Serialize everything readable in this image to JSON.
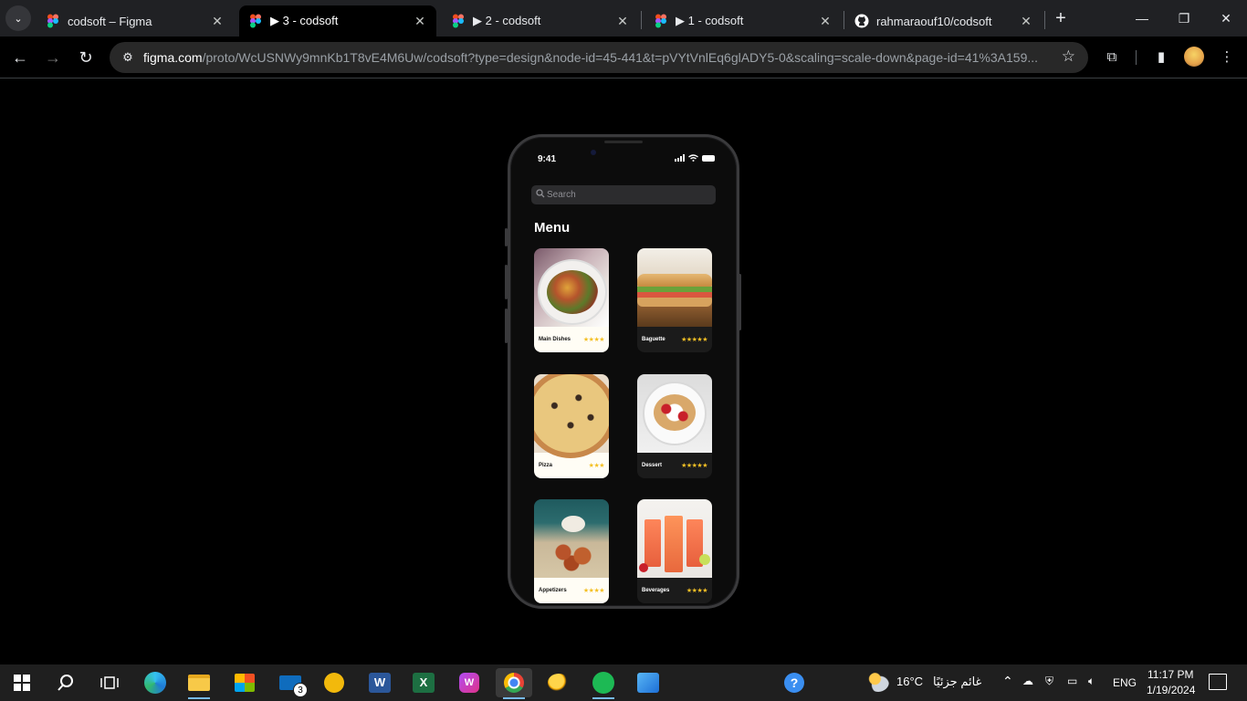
{
  "browser": {
    "tabs": [
      {
        "label": "codsoft – Figma",
        "active": false
      },
      {
        "label": "▶ 3 - codsoft",
        "active": true
      },
      {
        "label": "▶ 2 - codsoft",
        "active": false
      },
      {
        "label": "▶ 1 - codsoft",
        "active": false
      },
      {
        "label": "rahmaraouf10/codsoft",
        "active": false
      }
    ],
    "url_domain": "figma.com",
    "url_path": "/proto/WcUSNWy9mnKb1T8vE4M6Uw/codsoft?type=design&node-id=45-441&t=pVYtVnlEq6glADY5-0&scaling=scale-down&page-id=41%3A159..."
  },
  "phone": {
    "status_time": "9:41",
    "search_placeholder": "Search",
    "menu_title": "Menu",
    "cards": [
      {
        "label": "Main Dishes",
        "stars": "★★★★",
        "theme": "light"
      },
      {
        "label": "Baguette",
        "stars": "★★★★★",
        "theme": "dark"
      },
      {
        "label": "Pizza",
        "stars": "★★★",
        "theme": "light"
      },
      {
        "label": "Dessert",
        "stars": "★★★★★",
        "theme": "dark"
      },
      {
        "label": "Appetizers",
        "stars": "★★★★",
        "theme": "light"
      },
      {
        "label": "Beverages",
        "stars": "★★★★",
        "theme": "dark"
      }
    ]
  },
  "taskbar": {
    "mail_badge": "3",
    "weather_temp": "16°C",
    "weather_desc": "غائم جزئيًا",
    "language": "ENG",
    "time": "11:17 PM",
    "date": "1/19/2024"
  },
  "colors": {
    "accent": "#76b9ed",
    "star": "#f4c025",
    "figma": "#a259ff"
  }
}
